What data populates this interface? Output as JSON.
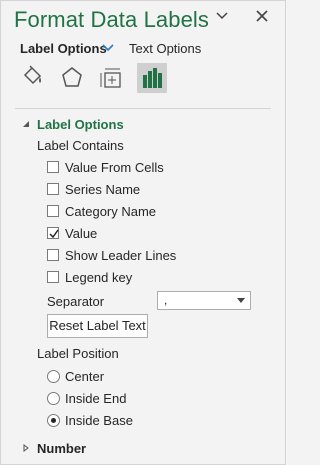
{
  "header": {
    "title": "Format Data Labels"
  },
  "tabs": {
    "label_options": "Label Options",
    "text_options": "Text Options"
  },
  "icons": [
    "fill-line-icon",
    "effects-icon",
    "size-properties-icon",
    "label-options-icon"
  ],
  "label_options_section": {
    "title": "Label Options",
    "label_contains": {
      "heading": "Label Contains",
      "items": [
        {
          "label": "Value From Cells",
          "checked": false
        },
        {
          "label": "Series Name",
          "checked": false
        },
        {
          "label": "Category Name",
          "checked": false
        },
        {
          "label": "Value",
          "checked": true
        },
        {
          "label": "Show Leader Lines",
          "checked": false
        },
        {
          "label": "Legend key",
          "checked": false
        }
      ]
    },
    "separator": {
      "label": "Separator",
      "value": ","
    },
    "reset_button": "Reset Label Text",
    "label_position": {
      "heading": "Label Position",
      "options": [
        {
          "label": "Center",
          "selected": false
        },
        {
          "label": "Inside End",
          "selected": false
        },
        {
          "label": "Inside Base",
          "selected": true
        }
      ]
    }
  },
  "number_section": {
    "title": "Number"
  },
  "colors": {
    "accent": "#217346",
    "background": "#f3f3f3"
  }
}
